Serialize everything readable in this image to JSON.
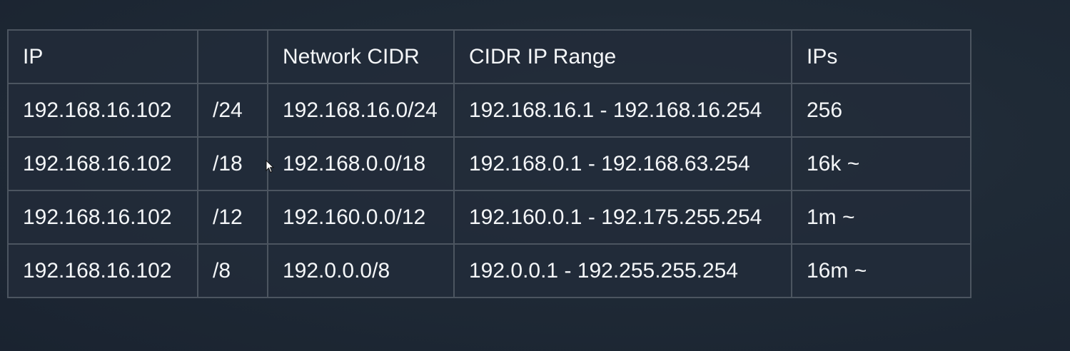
{
  "table": {
    "headers": [
      "IP",
      "",
      "Network CIDR",
      "CIDR IP Range",
      "IPs"
    ],
    "rows": [
      [
        "192.168.16.102",
        "/24",
        "192.168.16.0/24",
        "192.168.16.1 - 192.168.16.254",
        "256"
      ],
      [
        "192.168.16.102",
        "/18",
        "192.168.0.0/18",
        "192.168.0.1 - 192.168.63.254",
        "16k ~"
      ],
      [
        "192.168.16.102",
        "/12",
        "192.160.0.0/12",
        "192.160.0.1 - 192.175.255.254",
        "1m ~"
      ],
      [
        "192.168.16.102",
        "/8",
        "192.0.0.0/8",
        "192.0.0.1 - 192.255.255.254",
        "16m ~"
      ]
    ]
  },
  "colors": {
    "background": "#1f2a36",
    "border": "#4c5560",
    "text": "#f4f6f8"
  },
  "icons": {
    "cursor": "mouse-pointer-icon"
  }
}
